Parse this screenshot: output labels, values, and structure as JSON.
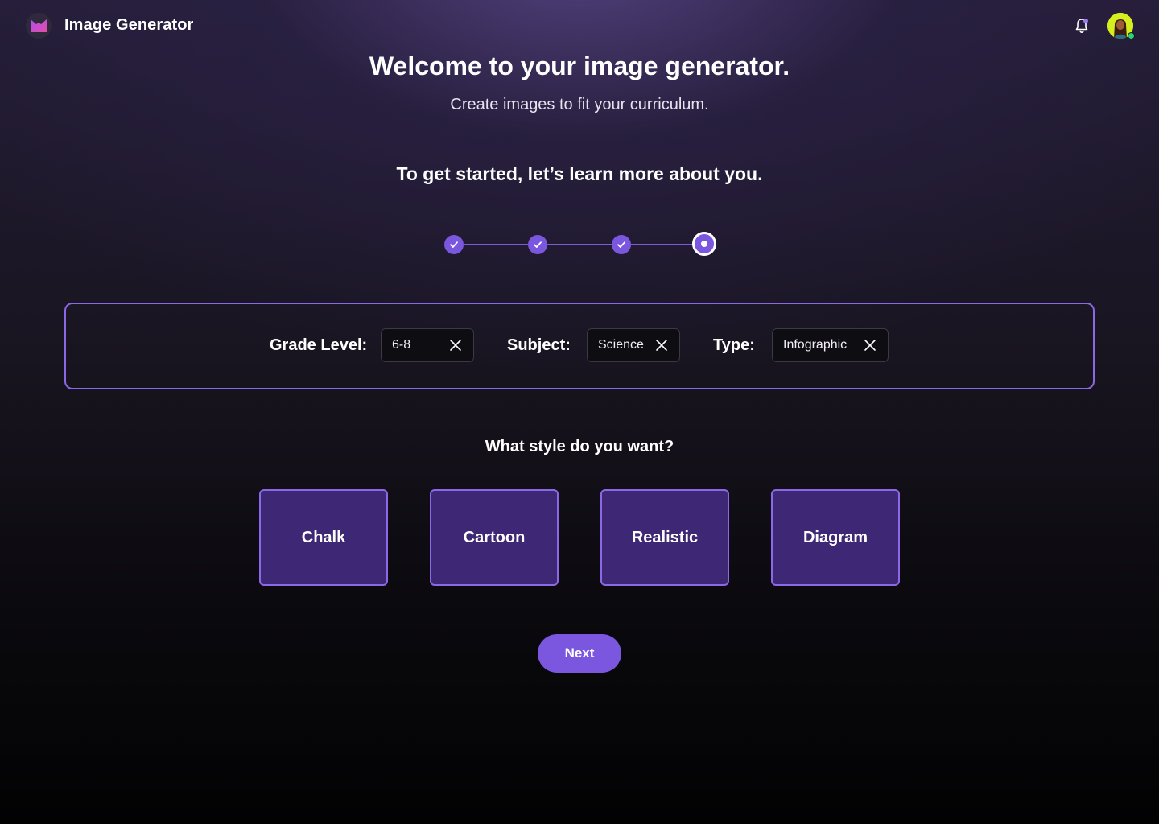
{
  "header": {
    "app_title": "Image Generator",
    "logo_icon": "m-logo-icon",
    "notification_icon": "bell-icon",
    "avatar_icon": "user-avatar"
  },
  "hero": {
    "title": "Welcome to your image generator.",
    "subtitle": "Create images to fit your curriculum.",
    "prompt": "To get started, let’s learn more about you."
  },
  "stepper": {
    "total_steps": 4,
    "completed_steps": 3,
    "current_step": 4
  },
  "filters": {
    "grade": {
      "label": "Grade Level:",
      "value": "6-8"
    },
    "subject": {
      "label": "Subject:",
      "value": "Science"
    },
    "type": {
      "label": "Type:",
      "value": "Infographic"
    }
  },
  "style_question": "What style do you want?",
  "styles": [
    "Chalk",
    "Cartoon",
    "Realistic",
    "Diagram"
  ],
  "next_label": "Next",
  "colors": {
    "accent": "#7b57e0",
    "card_fill": "#3e2775",
    "border": "#8a68e6"
  }
}
